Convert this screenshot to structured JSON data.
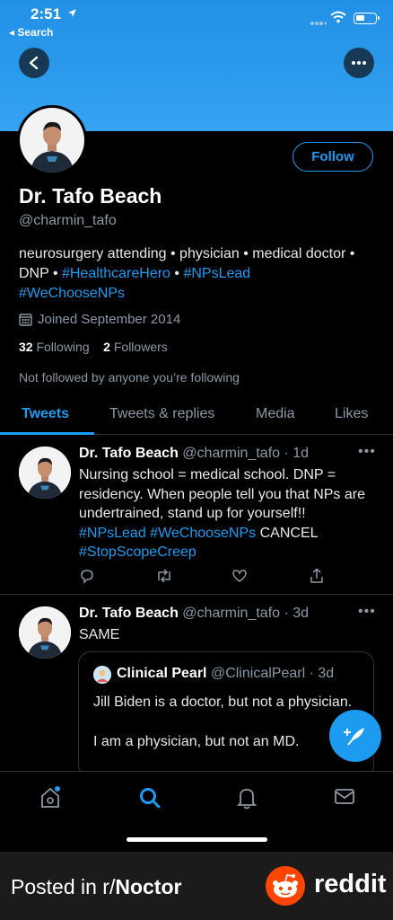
{
  "status_bar": {
    "time": "2:51",
    "back_label": "◂ Search"
  },
  "profile": {
    "follow_label": "Follow",
    "name": "Dr. Tafo Beach",
    "handle": "@charmin_tafo",
    "bio_text_1": "neurosurgery attending • physician • medical doctor • DNP • ",
    "bio_tag_1": "#HealthcareHero",
    "bio_sep": " • ",
    "bio_tag_2": "#NPsLead",
    "bio_tag_3": "#WeChooseNPs",
    "joined": "Joined September 2014",
    "following_count": "32",
    "following_label": "Following",
    "followers_count": "2",
    "followers_label": "Followers",
    "not_followed": "Not followed by anyone you’re following"
  },
  "tabs": [
    {
      "label": "Tweets",
      "active": true
    },
    {
      "label": "Tweets & replies"
    },
    {
      "label": "Media"
    },
    {
      "label": "Likes"
    }
  ],
  "tweets": [
    {
      "author": "Dr. Tafo Beach",
      "handle_time": "@charmin_tafo · 1d",
      "text": "Nursing school = medical school. DNP = residency. When people tell you that NPs are undertrained, stand up for yourself!! ",
      "tag1": "#NPsLead",
      "tag2": "#WeChooseNPs",
      "after_tags": " CANCEL ",
      "tag3": "#StopScopeCreep"
    },
    {
      "author": "Dr. Tafo Beach",
      "handle_time": "@charmin_tafo · 3d",
      "text": "SAME",
      "quote": {
        "author": "Clinical Pearl",
        "handle_time": "@ClinicalPearl · 3d",
        "text": "Jill Biden is a doctor, but not a physician.\n\nI am a physician, but not an MD."
      }
    }
  ],
  "footer": {
    "prefix": "Posted in r/",
    "subreddit": "Noctor",
    "brand": "reddit"
  },
  "colors": {
    "accent": "#1d9bf0",
    "banner": "#2a97eb",
    "reddit": "#ff4500"
  }
}
